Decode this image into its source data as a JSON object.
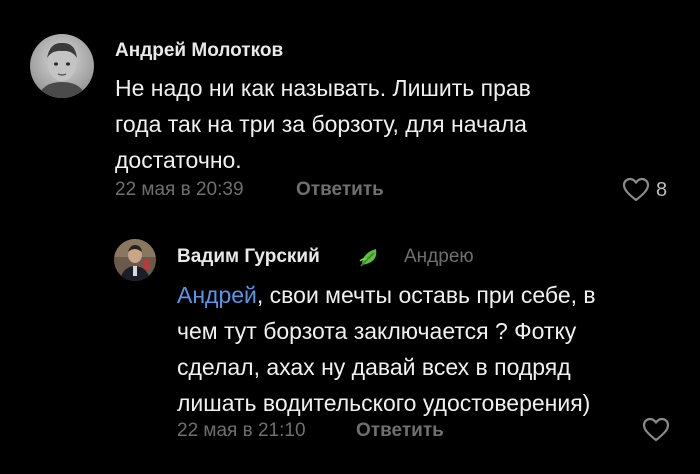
{
  "comments": [
    {
      "author": "Андрей Молотков",
      "text_lines": [
        "Не надо ни как называть. Лишить прав",
        "года так на три за борзоту, для начала",
        "достаточно."
      ],
      "timestamp": "22 мая в 20:39",
      "reply_label": "Ответить",
      "likes": "8",
      "avatar_icon": "avatar-photo-boy"
    },
    {
      "author": "Вадим Гурский",
      "badge_icon": "green-leaf-icon",
      "reply_to": "Андрею",
      "mention": "Андрей",
      "text_first_line_rest": ", свои мечты оставь при себе, в",
      "text_lines": [
        "чем тут борзота заключается ? Фотку",
        "сделал, ахах ну давай всех в подряд",
        "лишать водительского удостоверения)"
      ],
      "timestamp": "22 мая в 21:10",
      "reply_label": "Ответить",
      "likes": "",
      "avatar_icon": "avatar-photo-man"
    }
  ],
  "colors": {
    "background": "#000000",
    "author": "#e9e9e9",
    "text": "#f0f0f0",
    "meta": "#6f6f6f",
    "mention": "#5b95e8",
    "leaf": "#5fbf3a"
  }
}
